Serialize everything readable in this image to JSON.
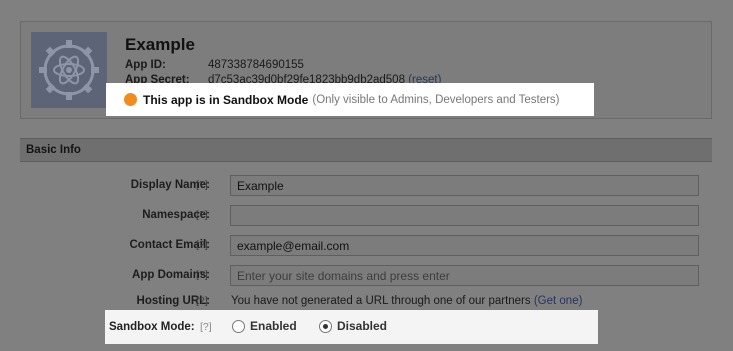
{
  "app": {
    "name": "Example",
    "app_id_label": "App ID:",
    "app_id": "487338784690155",
    "app_secret_label": "App Secret:",
    "app_secret": "d7c53ac39d0bf29fe1823bb9db2ad508",
    "reset_label": "(reset)",
    "icon": "atom-gear-icon"
  },
  "banner": {
    "status": "This app is in Sandbox Mode",
    "note": "(Only visible to Admins, Developers and Testers)",
    "dot_color": "#f28c1e"
  },
  "section": {
    "title": "Basic Info"
  },
  "form": {
    "display_name": {
      "label": "Display Name:",
      "help": "[?]",
      "value": "Example"
    },
    "namespace": {
      "label": "Namespace:",
      "help": "[?]",
      "value": ""
    },
    "contact_email": {
      "label": "Contact Email:",
      "help": "[?]",
      "value": "example@email.com"
    },
    "app_domains": {
      "label": "App Domains:",
      "help": "[?]",
      "placeholder": "Enter your site domains and press enter"
    },
    "hosting_url": {
      "label": "Hosting URL:",
      "help": "[?]",
      "text": "You have not generated a URL through one of our partners",
      "link": "(Get one)"
    },
    "sandbox_mode": {
      "label": "Sandbox Mode:",
      "help": "[?]",
      "option_enabled": "Enabled",
      "option_disabled": "Disabled",
      "selected": "Disabled"
    }
  }
}
